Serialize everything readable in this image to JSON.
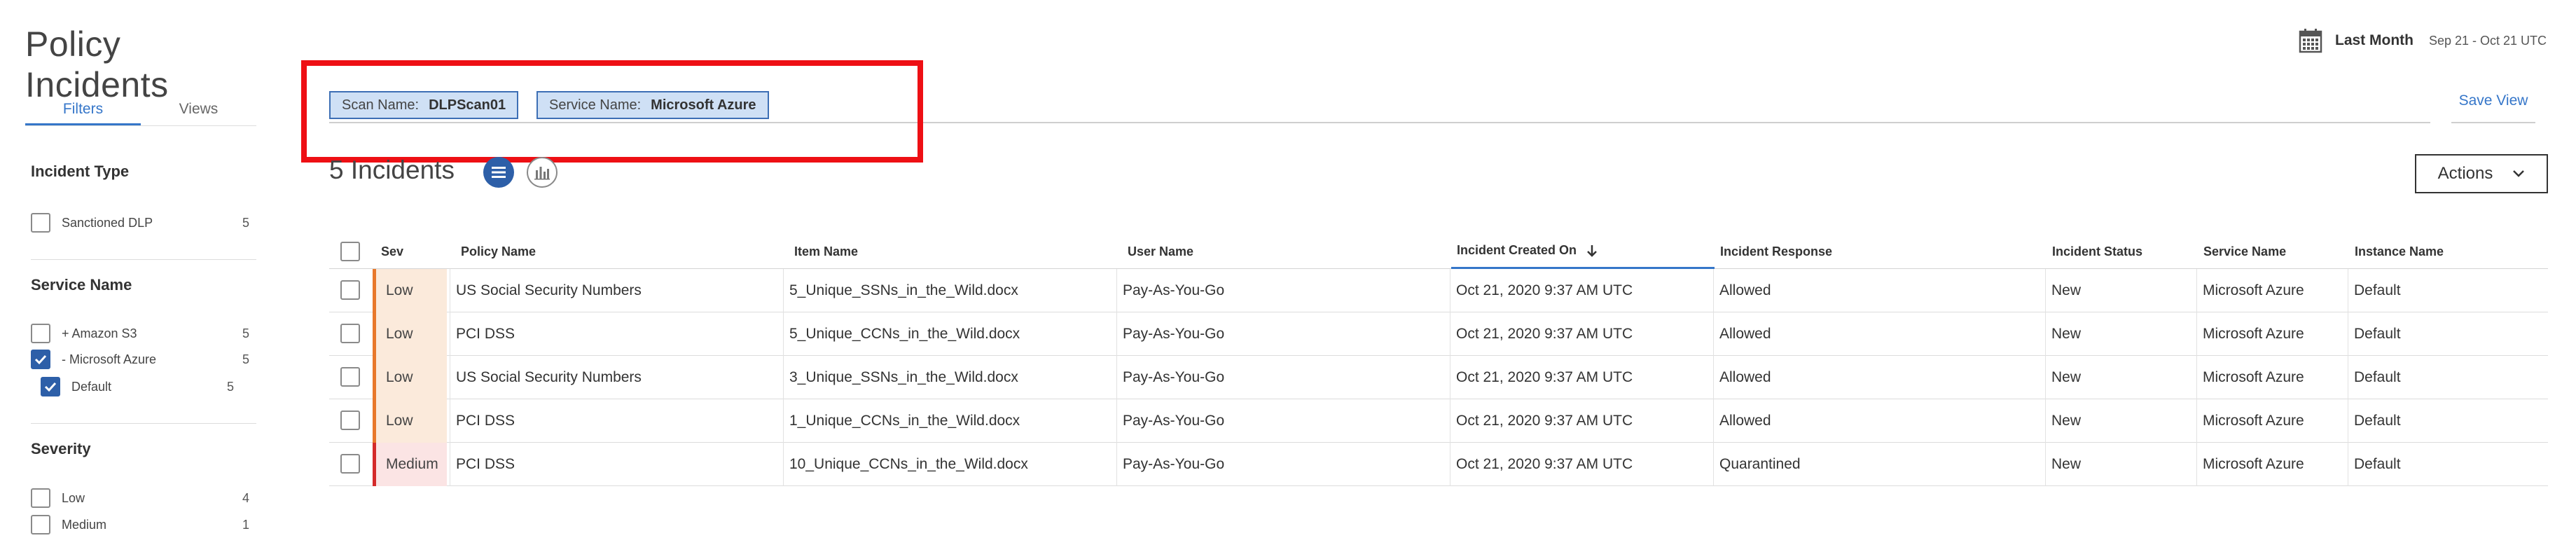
{
  "page_title": "Policy Incidents",
  "side_tabs": [
    "Filters",
    "Views"
  ],
  "facets": {
    "incident_type": {
      "title": "Incident Type",
      "items": [
        {
          "label": "Sanctioned DLP",
          "count": "5"
        }
      ]
    },
    "service_name": {
      "title": "Service Name",
      "items": [
        {
          "label": "+ Amazon S3",
          "count": "5"
        },
        {
          "label": "- Microsoft Azure",
          "count": "5"
        },
        {
          "label": "Default",
          "count": "5"
        }
      ]
    },
    "severity": {
      "title": "Severity",
      "items": [
        {
          "label": "Low",
          "count": "4"
        },
        {
          "label": "Medium",
          "count": "1"
        }
      ]
    }
  },
  "filters": {
    "chips": [
      {
        "key": "Scan Name:",
        "value": "DLPScan01"
      },
      {
        "key": "Service Name:",
        "value": "Microsoft Azure"
      }
    ],
    "save_view": "Save View"
  },
  "date_range": {
    "label": "Last Month",
    "dates": "Sep 21 - Oct 21 UTC"
  },
  "incidents": {
    "count_label": "5 Incidents",
    "actions_label": "Actions"
  },
  "table": {
    "columns": {
      "sev": "Sev",
      "policy": "Policy Name",
      "item": "Item Name",
      "user": "User Name",
      "created": "Incident Created On",
      "response": "Incident Response",
      "status": "Incident Status",
      "service": "Service Name",
      "instance": "Instance Name"
    },
    "rows": [
      {
        "sev": "Low",
        "policy": "US Social Security Numbers",
        "item": "5_Unique_SSNs_in_the_Wild.docx",
        "user": "Pay-As-You-Go",
        "created": "Oct 21, 2020 9:37 AM UTC",
        "response": "Allowed",
        "status": "New",
        "service": "Microsoft Azure",
        "instance": "Default"
      },
      {
        "sev": "Low",
        "policy": "PCI DSS",
        "item": "5_Unique_CCNs_in_the_Wild.docx",
        "user": "Pay-As-You-Go",
        "created": "Oct 21, 2020 9:37 AM UTC",
        "response": "Allowed",
        "status": "New",
        "service": "Microsoft Azure",
        "instance": "Default"
      },
      {
        "sev": "Low",
        "policy": "US Social Security Numbers",
        "item": "3_Unique_SSNs_in_the_Wild.docx",
        "user": "Pay-As-You-Go",
        "created": "Oct 21, 2020 9:37 AM UTC",
        "response": "Allowed",
        "status": "New",
        "service": "Microsoft Azure",
        "instance": "Default"
      },
      {
        "sev": "Low",
        "policy": "PCI DSS",
        "item": "1_Unique_CCNs_in_the_Wild.docx",
        "user": "Pay-As-You-Go",
        "created": "Oct 21, 2020 9:37 AM UTC",
        "response": "Allowed",
        "status": "New",
        "service": "Microsoft Azure",
        "instance": "Default"
      },
      {
        "sev": "Medium",
        "policy": "PCI DSS",
        "item": "10_Unique_CCNs_in_the_Wild.docx",
        "user": "Pay-As-You-Go",
        "created": "Oct 21, 2020 9:37 AM UTC",
        "response": "Quarantined",
        "status": "New",
        "service": "Microsoft Azure",
        "instance": "Default"
      }
    ]
  },
  "colors": {
    "accent": "#3576c9",
    "checkbox_checked": "#2d5fa8",
    "sev_low": "#e8782b",
    "sev_medium": "#d42a2a",
    "highlight": "#ee0f14"
  },
  "icons": [
    "calendar-icon",
    "list-view-icon",
    "chart-view-icon",
    "chevron-down-icon",
    "sort-down-arrow-icon",
    "checkmark-icon"
  ]
}
